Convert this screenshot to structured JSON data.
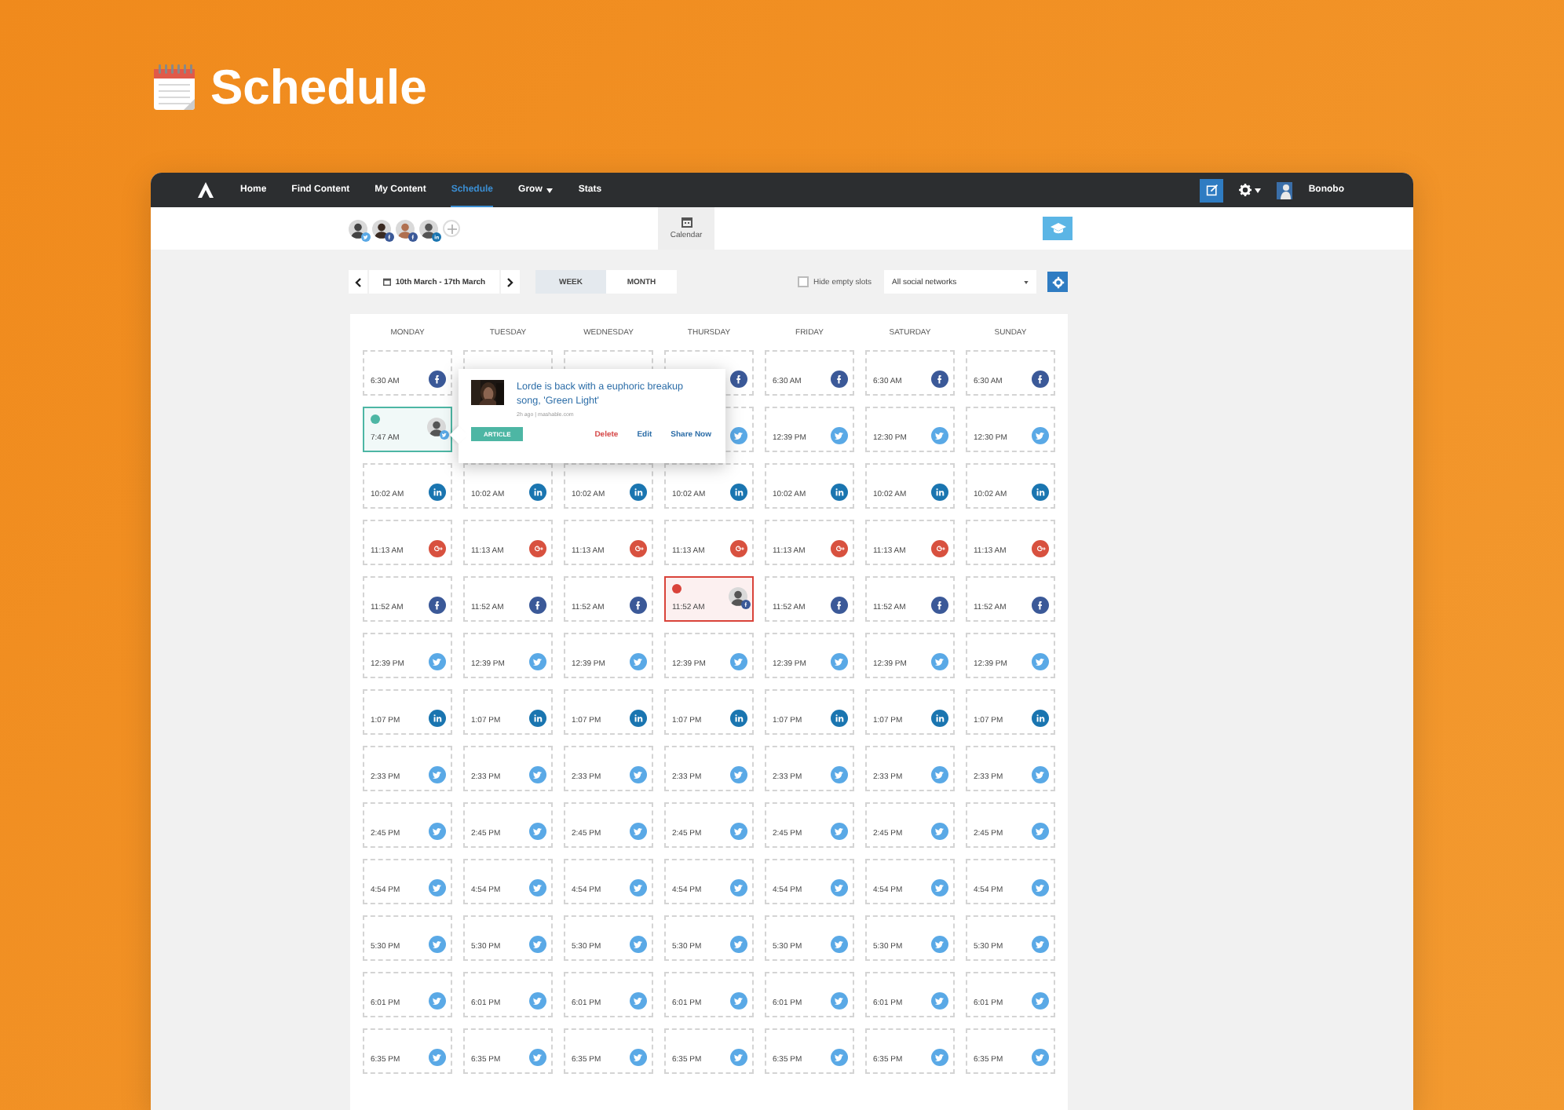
{
  "page_title": "Schedule",
  "nav": {
    "items": [
      {
        "label": "Home",
        "selected": false
      },
      {
        "label": "Find Content",
        "selected": false
      },
      {
        "label": "My Content",
        "selected": false
      },
      {
        "label": "Schedule",
        "selected": true
      },
      {
        "label": "Grow",
        "selected": false,
        "dropdown": true
      },
      {
        "label": "Stats",
        "selected": false
      }
    ],
    "user": "Bonobo"
  },
  "accounts": [
    {
      "kind": "twitter"
    },
    {
      "kind": "facebook"
    },
    {
      "kind": "facebook"
    },
    {
      "kind": "linkedin"
    }
  ],
  "view_tab": {
    "label": "Calendar",
    "selected": true
  },
  "toolbar": {
    "date_range": "10th March - 17th March",
    "views": [
      {
        "label": "WEEK",
        "selected": true
      },
      {
        "label": "MONTH",
        "selected": false
      }
    ],
    "hide_empty": {
      "label": "Hide empty slots",
      "checked": false
    },
    "network_filter": "All social networks"
  },
  "days": [
    "MONDAY",
    "TUESDAY",
    "WEDNESDAY",
    "THURSDAY",
    "FRIDAY",
    "SATURDAY",
    "SUNDAY"
  ],
  "rows": [
    {
      "cells": [
        {
          "time": "6:30 AM",
          "kind": "facebook"
        },
        {},
        {},
        {
          "kind": "facebook"
        },
        {
          "time": "6:30 AM",
          "kind": "facebook"
        },
        {
          "time": "6:30 AM",
          "kind": "facebook"
        },
        {
          "time": "6:30 AM",
          "kind": "facebook"
        }
      ]
    },
    {
      "cells": [
        {
          "time": "7:47 AM",
          "kind": "twitter",
          "color": "#4db6a4"
        },
        null,
        null,
        {
          "kind": "twitter"
        },
        {
          "time": "12:39 PM",
          "kind": "twitter"
        },
        {
          "time": "12:30 PM",
          "kind": "twitter"
        },
        {
          "time": "12:30 PM",
          "kind": "twitter"
        }
      ]
    },
    {
      "cells": [
        {
          "time": "10:02 AM",
          "kind": "linkedin"
        },
        {
          "time": "10:02 AM",
          "kind": "linkedin"
        },
        {
          "time": "10:02 AM",
          "kind": "linkedin"
        },
        {
          "time": "10:02 AM",
          "kind": "linkedin"
        },
        {
          "time": "10:02 AM",
          "kind": "linkedin"
        },
        {
          "time": "10:02 AM",
          "kind": "linkedin"
        },
        {
          "time": "10:02 AM",
          "kind": "linkedin"
        }
      ]
    },
    {
      "cells": [
        {
          "time": "11:13 AM",
          "kind": "google_plus"
        },
        {
          "time": "11:13 AM",
          "kind": "google_plus"
        },
        {
          "time": "11:13 AM",
          "kind": "google_plus"
        },
        {
          "time": "11:13 AM",
          "kind": "google_plus"
        },
        {
          "time": "11:13 AM",
          "kind": "google_plus"
        },
        {
          "time": "11:13 AM",
          "kind": "google_plus"
        },
        {
          "time": "11:13 AM",
          "kind": "google_plus"
        }
      ]
    },
    {
      "cells": [
        {
          "time": "11:52 AM",
          "kind": "facebook"
        },
        {
          "time": "11:52 AM",
          "kind": "facebook"
        },
        {
          "time": "11:52 AM",
          "kind": "facebook"
        },
        {
          "time": "11:52 AM",
          "kind": "facebook",
          "color": "#d9433a"
        },
        {
          "time": "11:52 AM",
          "kind": "facebook"
        },
        {
          "time": "11:52 AM",
          "kind": "facebook"
        },
        {
          "time": "11:52 AM",
          "kind": "facebook"
        }
      ]
    },
    {
      "cells": [
        {
          "time": "12:39 PM",
          "kind": "twitter"
        },
        {
          "time": "12:39 PM",
          "kind": "twitter"
        },
        {
          "time": "12:39 PM",
          "kind": "twitter"
        },
        {
          "time": "12:39 PM",
          "kind": "twitter"
        },
        {
          "time": "12:39 PM",
          "kind": "twitter"
        },
        {
          "time": "12:39 PM",
          "kind": "twitter"
        },
        {
          "time": "12:39 PM",
          "kind": "twitter"
        }
      ]
    },
    {
      "cells": [
        {
          "time": "1:07 PM",
          "kind": "linkedin"
        },
        {
          "time": "1:07 PM",
          "kind": "linkedin"
        },
        {
          "time": "1:07 PM",
          "kind": "linkedin"
        },
        {
          "time": "1:07 PM",
          "kind": "linkedin"
        },
        {
          "time": "1:07 PM",
          "kind": "linkedin"
        },
        {
          "time": "1:07 PM",
          "kind": "linkedin"
        },
        {
          "time": "1:07 PM",
          "kind": "linkedin"
        }
      ]
    },
    {
      "cells": [
        {
          "time": "2:33 PM",
          "kind": "twitter"
        },
        {
          "time": "2:33 PM",
          "kind": "twitter"
        },
        {
          "time": "2:33 PM",
          "kind": "twitter"
        },
        {
          "time": "2:33 PM",
          "kind": "twitter"
        },
        {
          "time": "2:33 PM",
          "kind": "twitter"
        },
        {
          "time": "2:33 PM",
          "kind": "twitter"
        },
        {
          "time": "2:33 PM",
          "kind": "twitter"
        }
      ]
    },
    {
      "cells": [
        {
          "time": "2:45 PM",
          "kind": "twitter"
        },
        {
          "time": "2:45 PM",
          "kind": "twitter"
        },
        {
          "time": "2:45 PM",
          "kind": "twitter"
        },
        {
          "time": "2:45 PM",
          "kind": "twitter"
        },
        {
          "time": "2:45 PM",
          "kind": "twitter"
        },
        {
          "time": "2:45 PM",
          "kind": "twitter"
        },
        {
          "time": "2:45 PM",
          "kind": "twitter"
        }
      ]
    },
    {
      "cells": [
        {
          "time": "4:54 PM",
          "kind": "twitter"
        },
        {
          "time": "4:54 PM",
          "kind": "twitter"
        },
        {
          "time": "4:54 PM",
          "kind": "twitter"
        },
        {
          "time": "4:54 PM",
          "kind": "twitter"
        },
        {
          "time": "4:54 PM",
          "kind": "twitter"
        },
        {
          "time": "4:54 PM",
          "kind": "twitter"
        },
        {
          "time": "4:54 PM",
          "kind": "twitter"
        }
      ]
    },
    {
      "cells": [
        {
          "time": "5:30 PM",
          "kind": "twitter"
        },
        {
          "time": "5:30 PM",
          "kind": "twitter"
        },
        {
          "time": "5:30 PM",
          "kind": "twitter"
        },
        {
          "time": "5:30 PM",
          "kind": "twitter"
        },
        {
          "time": "5:30 PM",
          "kind": "twitter"
        },
        {
          "time": "5:30 PM",
          "kind": "twitter"
        },
        {
          "time": "5:30 PM",
          "kind": "twitter"
        }
      ]
    },
    {
      "cells": [
        {
          "time": "6:01 PM",
          "kind": "twitter"
        },
        {
          "time": "6:01 PM",
          "kind": "twitter"
        },
        {
          "time": "6:01 PM",
          "kind": "twitter"
        },
        {
          "time": "6:01 PM",
          "kind": "twitter"
        },
        {
          "time": "6:01 PM",
          "kind": "twitter"
        },
        {
          "time": "6:01 PM",
          "kind": "twitter"
        },
        {
          "time": "6:01 PM",
          "kind": "twitter"
        }
      ]
    },
    {
      "cells": [
        {
          "time": "6:35 PM",
          "kind": "twitter"
        },
        {
          "time": "6:35 PM",
          "kind": "twitter"
        },
        {
          "time": "6:35 PM",
          "kind": "twitter"
        },
        {
          "time": "6:35 PM",
          "kind": "twitter"
        },
        {
          "time": "6:35 PM",
          "kind": "twitter"
        },
        {
          "time": "6:35 PM",
          "kind": "twitter"
        },
        {
          "time": "6:35 PM",
          "kind": "twitter"
        }
      ]
    }
  ],
  "popup": {
    "title": "Lorde is back with a euphoric breakup song, 'Green Light'",
    "meta": "2h ago | mashable.com",
    "tag": "ARTICLE",
    "actions": [
      {
        "label": "Delete",
        "kind": "danger"
      },
      {
        "label": "Edit",
        "kind": "normal"
      },
      {
        "label": "Share Now",
        "kind": "normal"
      }
    ]
  }
}
